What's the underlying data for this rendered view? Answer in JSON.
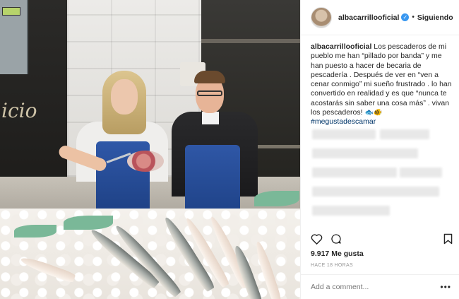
{
  "post": {
    "username": "albacarrillooficial",
    "verified_icon": "verified-badge-icon",
    "separator": "•",
    "follow_label": "Siguiendo",
    "caption_user": "albacarrillooficial",
    "caption_text": "Los pescaderos de mi pueblo me han “pillado por banda” y me han puesto a hacer de becaria de pescadería . Después de ver en “ven a cenar conmigo” mi sueño frustrado . lo han convertido en realidad y es que “nunca te acostarás sin saber una cosa más” . vivan los pescaderos!",
    "caption_emoji": "🐟🐠",
    "hashtag": "#megustadescamar",
    "likes": "9.917 Me gusta",
    "timestamp": "HACE 18 HORAS",
    "comment_placeholder": "Add a comment...",
    "more_label": "•••"
  },
  "icons": {
    "like": "heart-icon",
    "comment": "comment-bubble-icon",
    "save": "bookmark-icon",
    "more": "more-options-icon"
  },
  "colors": {
    "link": "#003569",
    "verified": "#3897f0",
    "text": "#262626",
    "muted": "#999999",
    "apron": "#1d3f82"
  }
}
